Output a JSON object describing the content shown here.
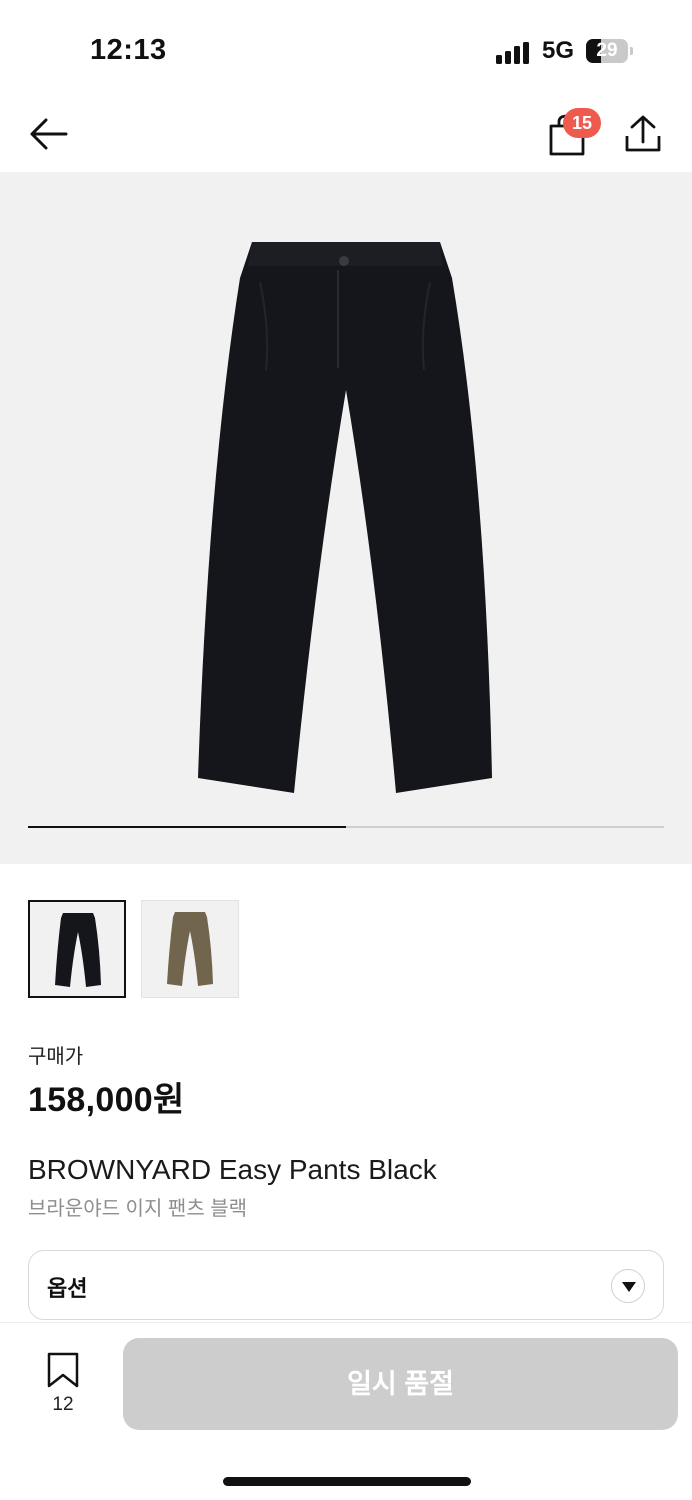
{
  "status_bar": {
    "time": "12:13",
    "network": "5G",
    "battery": "29"
  },
  "header": {
    "back_icon": "arrow-left-icon",
    "cart_icon": "shopping-bag-icon",
    "cart_badge": "15",
    "share_icon": "share-icon",
    "badge_color": "#ef5a4e"
  },
  "gallery": {
    "image_progress": 0.5,
    "thumbnails": [
      {
        "name": "black",
        "selected": true,
        "color": "#15161b"
      },
      {
        "name": "brown",
        "selected": false,
        "color": "#72654e"
      }
    ]
  },
  "product": {
    "price_label": "구매가",
    "price": "158,000원",
    "name_en": "BROWNYARD Easy Pants Black",
    "name_ko": "브라운야드 이지 팬츠 블랙"
  },
  "option": {
    "label": "옵션",
    "icon": "chevron-down-icon"
  },
  "bottom_bar": {
    "bookmark_icon": "bookmark-icon",
    "bookmark_count": "12",
    "soldout_label": "일시 품절"
  }
}
